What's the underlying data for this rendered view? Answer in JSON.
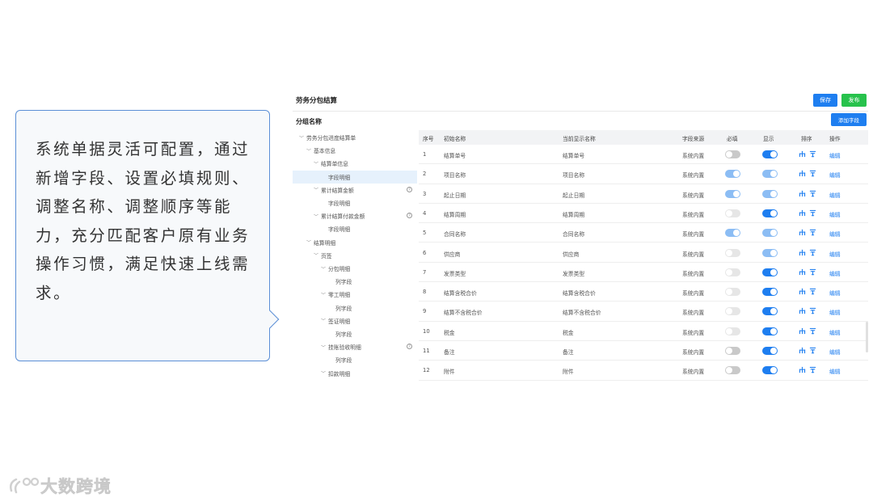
{
  "callout": {
    "text": "系统单据灵活可配置，通过新增字段、设置必填规则、调整名称、调整顺序等能力，充分匹配客户原有业务操作习惯，满足快速上线需求。"
  },
  "header": {
    "title": "劳务分包结算",
    "save_label": "保存",
    "publish_label": "发布"
  },
  "section": {
    "title": "分组名称",
    "add_field_label": "添加字段"
  },
  "tree": [
    {
      "label": "劳务分包进度结算单",
      "level": 0,
      "expanded": true,
      "active": false,
      "help": false
    },
    {
      "label": "基本信息",
      "level": 1,
      "expanded": true,
      "active": false,
      "help": false
    },
    {
      "label": "结算单信息",
      "level": 2,
      "expanded": true,
      "active": false,
      "help": false
    },
    {
      "label": "字段明细",
      "level": 3,
      "expanded": null,
      "active": true,
      "help": false
    },
    {
      "label": "累计结算金额",
      "level": 2,
      "expanded": true,
      "active": false,
      "help": true
    },
    {
      "label": "字段明细",
      "level": 3,
      "expanded": null,
      "active": false,
      "help": false
    },
    {
      "label": "累计结算付款金额",
      "level": 2,
      "expanded": true,
      "active": false,
      "help": true
    },
    {
      "label": "字段明细",
      "level": 3,
      "expanded": null,
      "active": false,
      "help": false
    },
    {
      "label": "结算明细",
      "level": 1,
      "expanded": true,
      "active": false,
      "help": false
    },
    {
      "label": "页签",
      "level": 2,
      "expanded": true,
      "active": false,
      "help": false
    },
    {
      "label": "分包明细",
      "level": 3,
      "expanded": true,
      "active": false,
      "help": false
    },
    {
      "label": "列字段",
      "level": 4,
      "expanded": null,
      "active": false,
      "help": false
    },
    {
      "label": "零工明细",
      "level": 3,
      "expanded": true,
      "active": false,
      "help": false
    },
    {
      "label": "列字段",
      "level": 4,
      "expanded": null,
      "active": false,
      "help": false
    },
    {
      "label": "签证明细",
      "level": 3,
      "expanded": true,
      "active": false,
      "help": false
    },
    {
      "label": "列字段",
      "level": 4,
      "expanded": null,
      "active": false,
      "help": false
    },
    {
      "label": "挂账验收明细",
      "level": 3,
      "expanded": true,
      "active": false,
      "help": true
    },
    {
      "label": "列字段",
      "level": 4,
      "expanded": null,
      "active": false,
      "help": false
    },
    {
      "label": "扣款明细",
      "level": 3,
      "expanded": true,
      "active": false,
      "help": false
    }
  ],
  "table": {
    "headers": {
      "index": "序号",
      "initial_name": "初始名称",
      "display_name": "当前显示名称",
      "source": "字段来源",
      "required": "必填",
      "visible": "显示",
      "order": "排序",
      "action": "操作"
    },
    "edit_label": "编辑",
    "rows": [
      {
        "index": "1",
        "initial": "结算单号",
        "display": "结算单号",
        "source": "系统内置",
        "required": "off",
        "visible": "on"
      },
      {
        "index": "2",
        "initial": "项目名称",
        "display": "项目名称",
        "source": "系统内置",
        "required": "on-light",
        "visible": "on-light"
      },
      {
        "index": "3",
        "initial": "起止日期",
        "display": "起止日期",
        "source": "系统内置",
        "required": "on-light",
        "visible": "on-light"
      },
      {
        "index": "4",
        "initial": "结算周期",
        "display": "结算周期",
        "source": "系统内置",
        "required": "off-light",
        "visible": "on"
      },
      {
        "index": "5",
        "initial": "合同名称",
        "display": "合同名称",
        "source": "系统内置",
        "required": "on-light",
        "visible": "on-light"
      },
      {
        "index": "6",
        "initial": "供应商",
        "display": "供应商",
        "source": "系统内置",
        "required": "off-light",
        "visible": "on-light"
      },
      {
        "index": "7",
        "initial": "发票类型",
        "display": "发票类型",
        "source": "系统内置",
        "required": "off-light",
        "visible": "on"
      },
      {
        "index": "8",
        "initial": "结算含税合价",
        "display": "结算含税合价",
        "source": "系统内置",
        "required": "off-light",
        "visible": "on"
      },
      {
        "index": "9",
        "initial": "结算不含税合价",
        "display": "结算不含税合价",
        "source": "系统内置",
        "required": "off-light",
        "visible": "on"
      },
      {
        "index": "10",
        "initial": "税金",
        "display": "税金",
        "source": "系统内置",
        "required": "off-light",
        "visible": "on"
      },
      {
        "index": "11",
        "initial": "备注",
        "display": "备注",
        "source": "系统内置",
        "required": "off",
        "visible": "on"
      },
      {
        "index": "12",
        "initial": "附件",
        "display": "附件",
        "source": "系统内置",
        "required": "off",
        "visible": "on"
      }
    ]
  },
  "watermark": {
    "text": "大数跨境"
  },
  "colors": {
    "primary": "#1e7ef0",
    "publish": "#27c24c",
    "callout_border": "#5b8fd6"
  }
}
